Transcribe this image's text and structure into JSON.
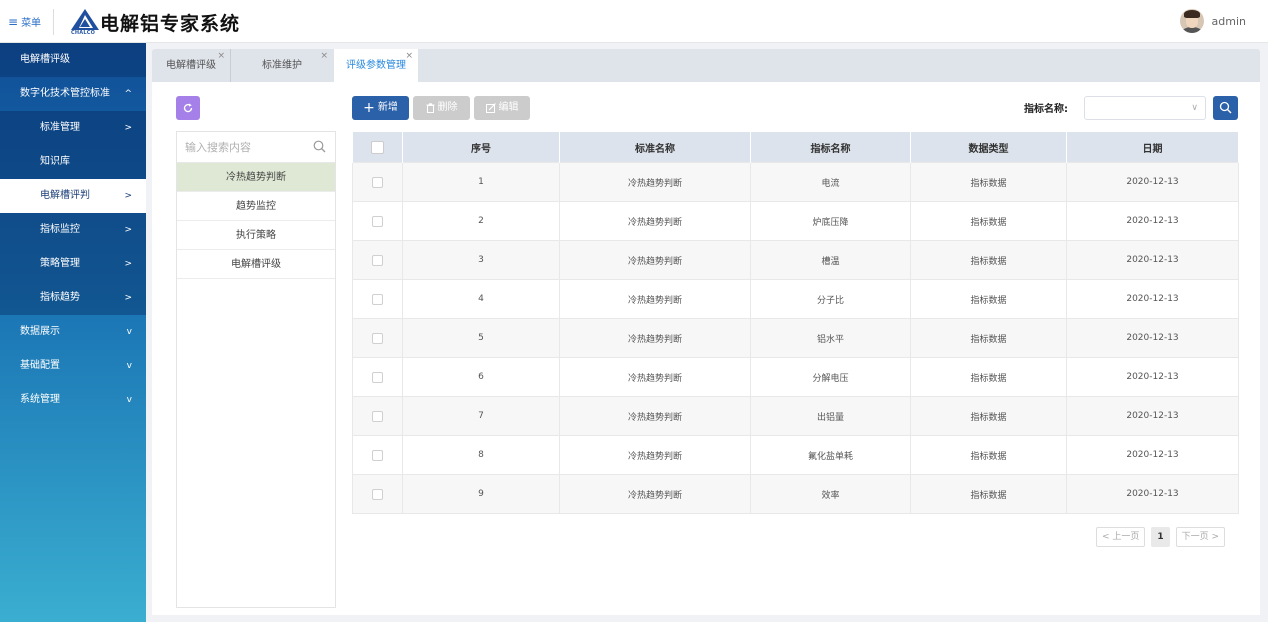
{
  "header": {
    "menu_label": "菜单",
    "app_title": "电解铝专家系统",
    "logo_text": "CHALCO",
    "username": "admin"
  },
  "sidebar": {
    "items": [
      {
        "label": "电解槽评级",
        "chev": ""
      },
      {
        "label": "数字化技术管控标准",
        "chev": "^"
      },
      {
        "label": "标准管理",
        "chev": ">"
      },
      {
        "label": "知识库",
        "chev": ""
      },
      {
        "label": "电解槽评判",
        "chev": ">"
      },
      {
        "label": "指标监控",
        "chev": ">"
      },
      {
        "label": "策略管理",
        "chev": ">"
      },
      {
        "label": "指标趋势",
        "chev": ">"
      },
      {
        "label": "数据展示",
        "chev": "v"
      },
      {
        "label": "基础配置",
        "chev": "v"
      },
      {
        "label": "系统管理",
        "chev": "v"
      }
    ]
  },
  "tabs": [
    {
      "label": "电解槽评级",
      "close": "×"
    },
    {
      "label": "标准维护",
      "close": "×"
    },
    {
      "label": "评级参数管理",
      "close": "×"
    }
  ],
  "toolbar": {
    "refresh_icon": "refresh-icon",
    "add_label": "新增",
    "delete_label": "删除",
    "edit_label": "编辑",
    "filter_label": "指标名称:",
    "filter_value": ""
  },
  "tree": {
    "search_placeholder": "输入搜索内容",
    "items": [
      "冷热趋势判断",
      "趋势监控",
      "执行策略",
      "电解槽评级"
    ]
  },
  "table": {
    "columns": [
      "序号",
      "标准名称",
      "指标名称",
      "数据类型",
      "日期"
    ],
    "rows": [
      {
        "no": "1",
        "std": "冷热趋势判断",
        "ind": "电流",
        "type": "指标数据",
        "date": "2020-12-13"
      },
      {
        "no": "2",
        "std": "冷热趋势判断",
        "ind": "炉底压降",
        "type": "指标数据",
        "date": "2020-12-13"
      },
      {
        "no": "3",
        "std": "冷热趋势判断",
        "ind": "槽温",
        "type": "指标数据",
        "date": "2020-12-13"
      },
      {
        "no": "4",
        "std": "冷热趋势判断",
        "ind": "分子比",
        "type": "指标数据",
        "date": "2020-12-13"
      },
      {
        "no": "5",
        "std": "冷热趋势判断",
        "ind": "铝水平",
        "type": "指标数据",
        "date": "2020-12-13"
      },
      {
        "no": "6",
        "std": "冷热趋势判断",
        "ind": "分解电压",
        "type": "指标数据",
        "date": "2020-12-13"
      },
      {
        "no": "7",
        "std": "冷热趋势判断",
        "ind": "出铝量",
        "type": "指标数据",
        "date": "2020-12-13"
      },
      {
        "no": "8",
        "std": "冷热趋势判断",
        "ind": "氟化盐单耗",
        "type": "指标数据",
        "date": "2020-12-13"
      },
      {
        "no": "9",
        "std": "冷热趋势判断",
        "ind": "效率",
        "type": "指标数据",
        "date": "2020-12-13"
      }
    ]
  },
  "pager": {
    "prev": "< 上一页",
    "current": "1",
    "next": "下一页 >"
  }
}
